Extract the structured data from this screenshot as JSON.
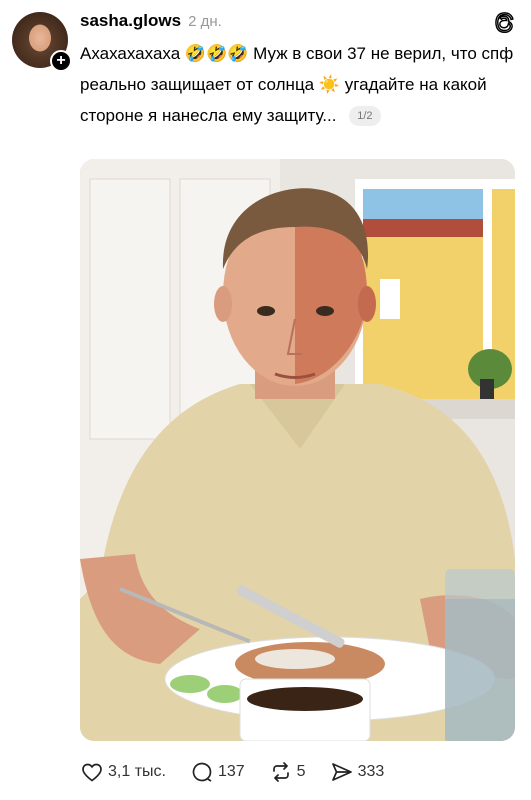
{
  "post": {
    "username": "sasha.glows",
    "time": "2 дн.",
    "text_part1": "Ахахахахаха",
    "emoji_laugh": "🤣🤣🤣",
    "text_part2": "Муж в свои 37 не верил, что спф реально защищает от солнца",
    "emoji_sun": "☀️",
    "text_part3": "угадайте на какой стороне я нанесла ему защиту...",
    "image_counter": "1/2"
  },
  "actions": {
    "likes": "3,1 тыс.",
    "comments": "137",
    "reposts": "5",
    "shares": "333"
  },
  "icons": {
    "avatar_badge": "plus-icon",
    "app_logo": "threads-logo-icon",
    "like": "heart-icon",
    "comment": "comment-icon",
    "repost": "repost-icon",
    "share": "send-icon"
  }
}
